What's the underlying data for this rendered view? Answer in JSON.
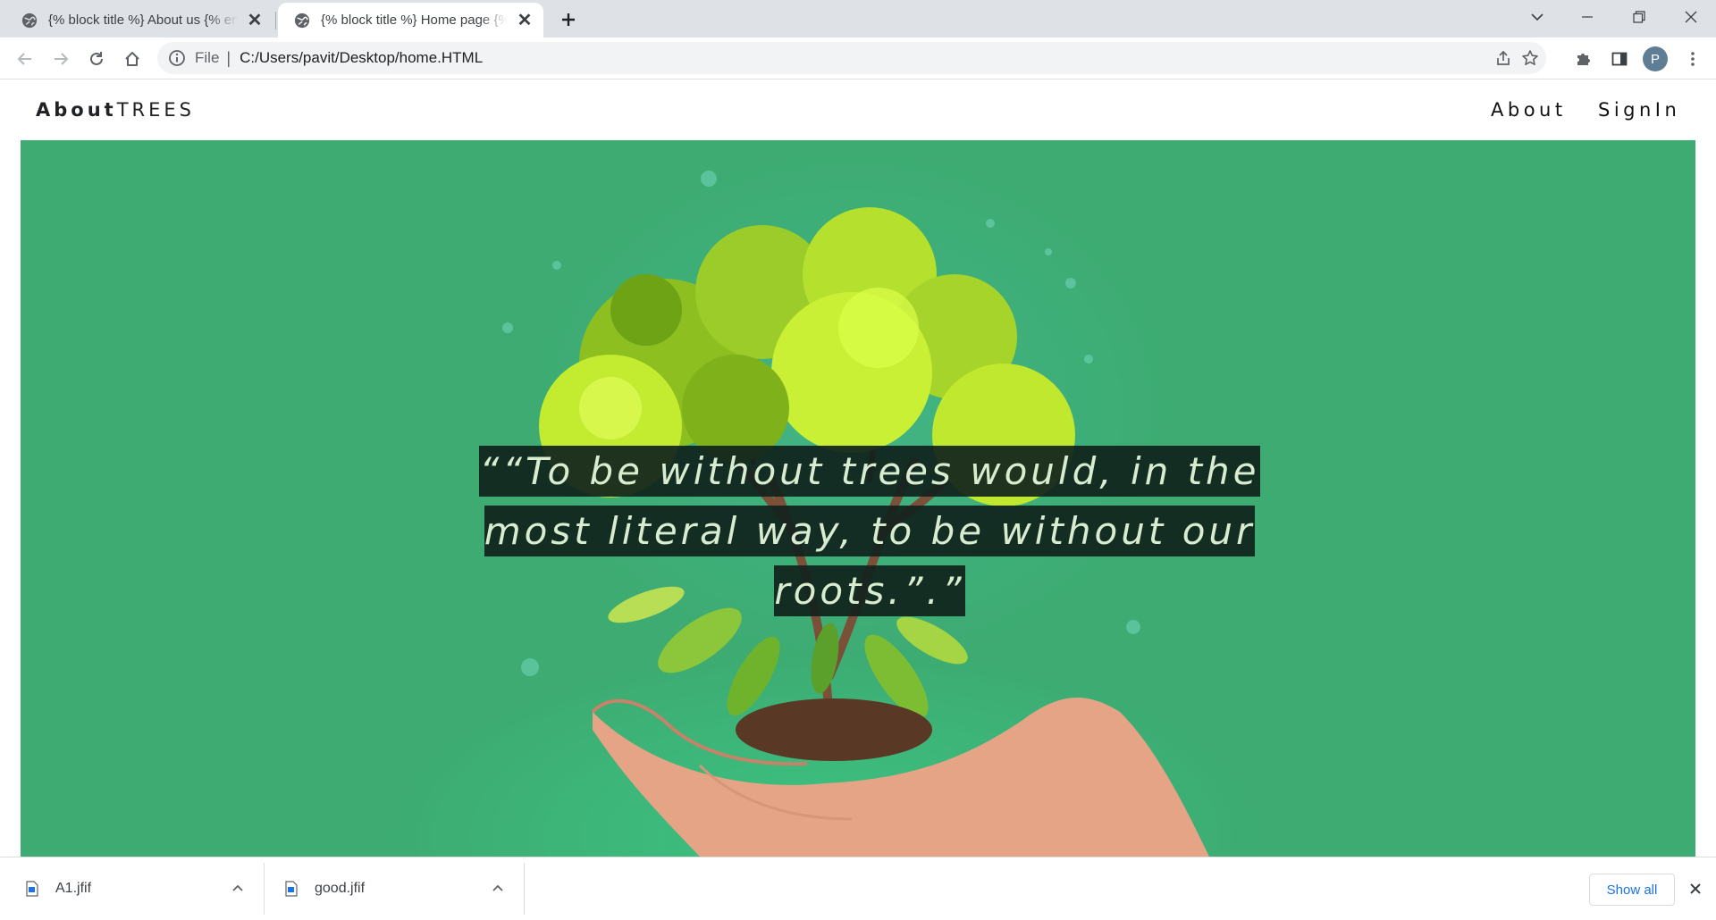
{
  "browser": {
    "tabs": [
      {
        "title": "{% block title %} About us {% endblock %}",
        "active": false
      },
      {
        "title": "{% block title %} Home page {% endblock %}",
        "active": true
      }
    ],
    "address": {
      "scheme": "File",
      "separator": "|",
      "url": "C:/Users/pavit/Desktop/home.HTML"
    },
    "profile_initial": "P"
  },
  "site": {
    "brand_bold": "About",
    "brand_light": "TREES",
    "nav": [
      {
        "label": "About"
      },
      {
        "label": "SignIn"
      }
    ],
    "quote": "““To be without trees would, in the most literal way, to be without our roots.”.”"
  },
  "downloads": {
    "items": [
      {
        "filename": "A1.jfif"
      },
      {
        "filename": "good.jfif"
      }
    ],
    "show_all_label": "Show all"
  },
  "colors": {
    "hero_bg": "#3dab72",
    "quote_bg": "#10221c",
    "quote_text": "#d8ecd0",
    "link_blue": "#1a73e8"
  },
  "icons": {
    "tab_favicon": "globe-icon",
    "tab_close": "close-icon",
    "new_tab": "plus-icon",
    "back": "arrow-left-icon",
    "forward": "arrow-right-icon",
    "reload": "reload-icon",
    "home": "home-icon",
    "site_info": "info-icon",
    "share": "share-icon",
    "bookmark": "star-icon",
    "extensions": "puzzle-icon",
    "side_panel": "side-panel-icon",
    "menu": "kebab-menu-icon",
    "file": "file-icon",
    "caret": "chevron-up-icon"
  }
}
